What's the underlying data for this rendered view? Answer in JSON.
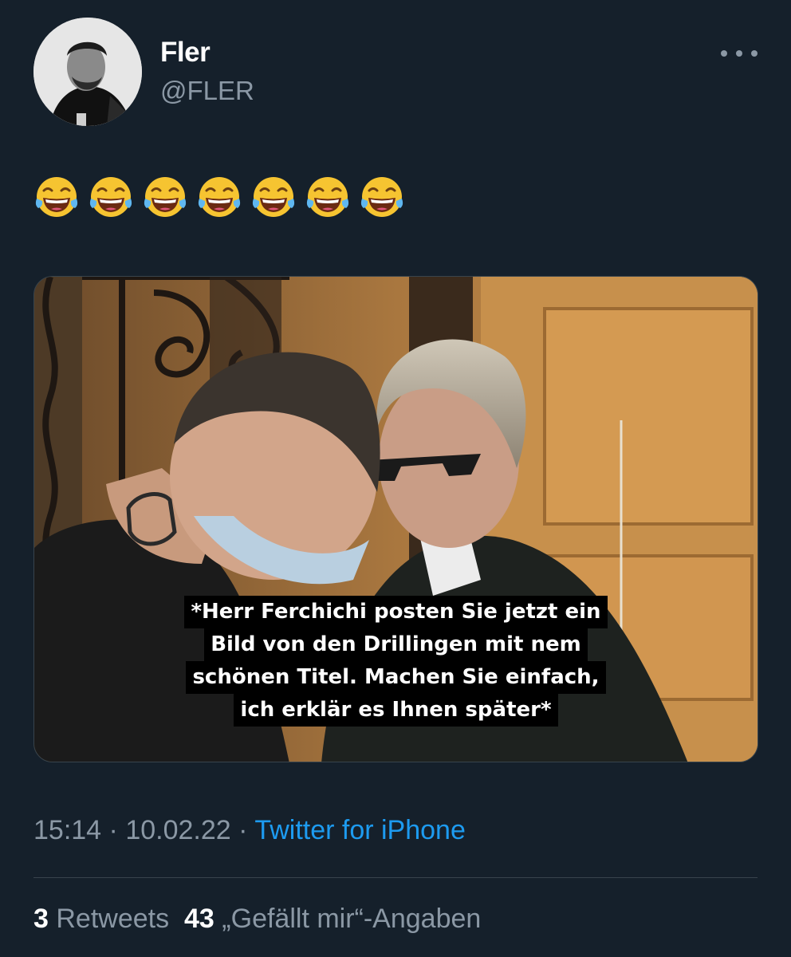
{
  "author": {
    "display_name": "Fler",
    "handle": "@FLER"
  },
  "header": {
    "more_icon": "more-horizontal-icon"
  },
  "tweet": {
    "emojis": [
      "😂",
      "😂",
      "😂",
      "😂",
      "😂",
      "😂",
      "😂"
    ],
    "media_caption": [
      "*Herr Ferchichi posten Sie jetzt ein",
      "Bild von den Drillingen mit nem",
      "schönen Titel. Machen Sie einfach,",
      "ich erklär es Ihnen später*"
    ]
  },
  "meta": {
    "time": "15:14",
    "separator": "·",
    "date": "10.02.22",
    "source": "Twitter for iPhone"
  },
  "stats": {
    "retweets_count": "3",
    "retweets_label": "Retweets",
    "likes_count": "43",
    "likes_label": "„Gefällt mir“-Angaben"
  },
  "colors": {
    "background": "#15202b",
    "secondary_text": "#8b98a5",
    "link": "#1d9bf0"
  }
}
